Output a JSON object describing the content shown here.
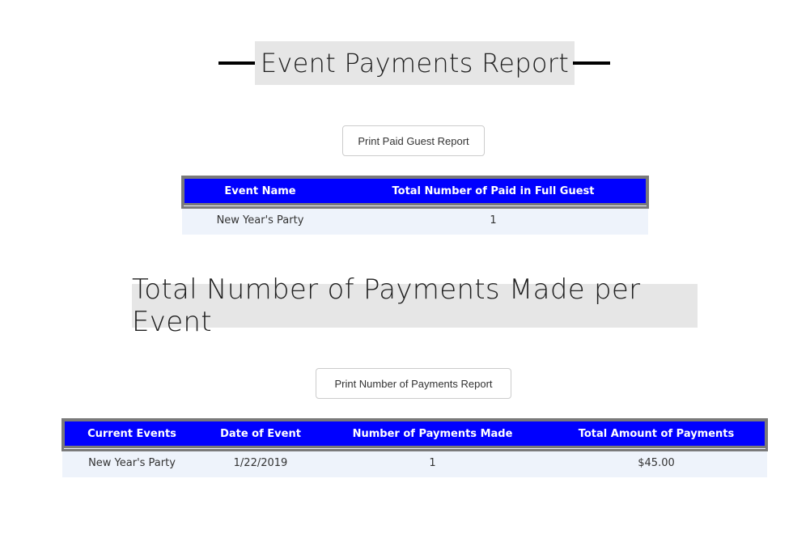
{
  "paid_guest_section": {
    "title": "Event Payments Report",
    "print_button": "Print Paid Guest Report",
    "table": {
      "headers": [
        "Event Name",
        "Total Number of Paid in Full Guest"
      ],
      "rows": [
        [
          "New Year's Party",
          "1"
        ]
      ]
    }
  },
  "payments_section": {
    "title": "Total Number of Payments Made per Event",
    "print_button": "Print Number of Payments Report",
    "table": {
      "headers": [
        "Current Events",
        "Date of Event",
        "Number of Payments Made",
        "Total Amount of Payments"
      ],
      "rows": [
        [
          "New Year's Party",
          "1/22/2019",
          "1",
          "$45.00"
        ]
      ]
    }
  },
  "colors": {
    "table_header_bg": "#0000ff",
    "table_row_bg": "#eef3fb",
    "heading_bg": "#e6e6e6"
  }
}
